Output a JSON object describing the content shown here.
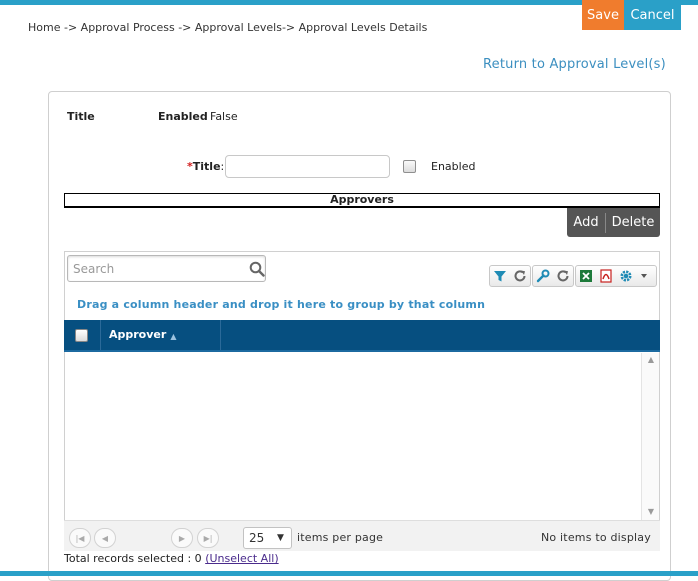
{
  "header": {
    "breadcrumb": "Home -> Approval Process -> Approval Levels-> Approval Levels Details",
    "save_label": "Save",
    "cancel_label": "Cancel",
    "return_link": "Return to Approval Level(s)"
  },
  "summary": {
    "title_label": "Title",
    "enabled_label": "Enabled",
    "enabled_value": "False"
  },
  "form": {
    "required_mark": "*",
    "title_label": "Title",
    "title_colon": ":",
    "title_value": "",
    "enabled_label": "Enabled",
    "enabled_checked": false
  },
  "approvers": {
    "section_title": "Approvers",
    "add_label": "Add",
    "delete_label": "Delete"
  },
  "grid": {
    "search_placeholder": "Search",
    "group_hint": "Drag a column header and drop it here to group by that column",
    "columns": [
      "Approver"
    ],
    "sort_indicator": "▲",
    "rows": [],
    "toolbar_icons": [
      "filter-icon",
      "refresh-icon",
      "wrench-icon",
      "reset-icon",
      "excel-icon",
      "pdf-icon",
      "gear-icon",
      "caret-down-icon"
    ],
    "colors": {
      "header_bg": "#064f80",
      "accent": "#2aa0c8",
      "save": "#f07c2d"
    }
  },
  "pager": {
    "page_size": "25",
    "items_per_page_label": "items per page",
    "empty_label": "No items to display"
  },
  "footer": {
    "selected_label": "Total records selected : 0",
    "unselect_link": "(Unselect All)"
  }
}
